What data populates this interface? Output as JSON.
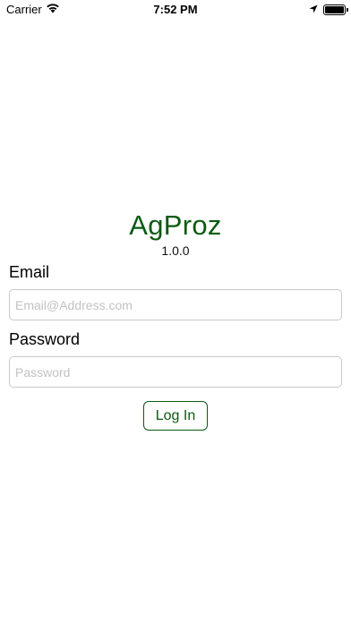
{
  "status_bar": {
    "carrier": "Carrier",
    "time": "7:52 PM",
    "battery_level": 1.0,
    "icons": [
      "wifi-icon",
      "location-arrow-icon",
      "battery-icon"
    ]
  },
  "app": {
    "title": "AgProz",
    "version": "1.0.0"
  },
  "login_form": {
    "email_label": "Email",
    "email_placeholder": "Email@Address.com",
    "email_value": "",
    "password_label": "Password",
    "password_placeholder": "Password",
    "password_value": "",
    "login_button_label": "Log In"
  },
  "colors": {
    "brand_green": "#0b5a12",
    "background": "#ffffff",
    "input_border": "#c8c8c8",
    "placeholder": "#c2c2c2"
  }
}
